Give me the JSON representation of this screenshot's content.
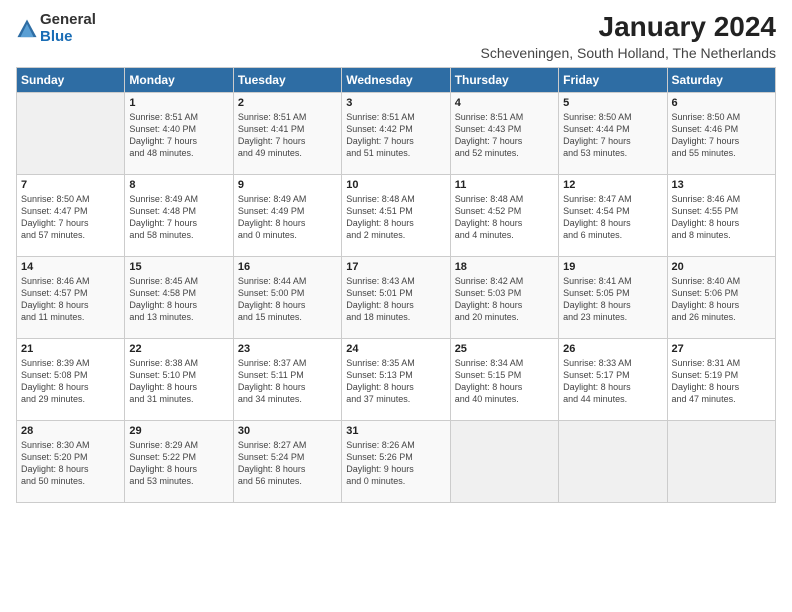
{
  "logo": {
    "general": "General",
    "blue": "Blue"
  },
  "header": {
    "title": "January 2024",
    "subtitle": "Scheveningen, South Holland, The Netherlands"
  },
  "days_of_week": [
    "Sunday",
    "Monday",
    "Tuesday",
    "Wednesday",
    "Thursday",
    "Friday",
    "Saturday"
  ],
  "weeks": [
    [
      {
        "day": "",
        "info": ""
      },
      {
        "day": "1",
        "info": "Sunrise: 8:51 AM\nSunset: 4:40 PM\nDaylight: 7 hours\nand 48 minutes."
      },
      {
        "day": "2",
        "info": "Sunrise: 8:51 AM\nSunset: 4:41 PM\nDaylight: 7 hours\nand 49 minutes."
      },
      {
        "day": "3",
        "info": "Sunrise: 8:51 AM\nSunset: 4:42 PM\nDaylight: 7 hours\nand 51 minutes."
      },
      {
        "day": "4",
        "info": "Sunrise: 8:51 AM\nSunset: 4:43 PM\nDaylight: 7 hours\nand 52 minutes."
      },
      {
        "day": "5",
        "info": "Sunrise: 8:50 AM\nSunset: 4:44 PM\nDaylight: 7 hours\nand 53 minutes."
      },
      {
        "day": "6",
        "info": "Sunrise: 8:50 AM\nSunset: 4:46 PM\nDaylight: 7 hours\nand 55 minutes."
      }
    ],
    [
      {
        "day": "7",
        "info": "Sunrise: 8:50 AM\nSunset: 4:47 PM\nDaylight: 7 hours\nand 57 minutes."
      },
      {
        "day": "8",
        "info": "Sunrise: 8:49 AM\nSunset: 4:48 PM\nDaylight: 7 hours\nand 58 minutes."
      },
      {
        "day": "9",
        "info": "Sunrise: 8:49 AM\nSunset: 4:49 PM\nDaylight: 8 hours\nand 0 minutes."
      },
      {
        "day": "10",
        "info": "Sunrise: 8:48 AM\nSunset: 4:51 PM\nDaylight: 8 hours\nand 2 minutes."
      },
      {
        "day": "11",
        "info": "Sunrise: 8:48 AM\nSunset: 4:52 PM\nDaylight: 8 hours\nand 4 minutes."
      },
      {
        "day": "12",
        "info": "Sunrise: 8:47 AM\nSunset: 4:54 PM\nDaylight: 8 hours\nand 6 minutes."
      },
      {
        "day": "13",
        "info": "Sunrise: 8:46 AM\nSunset: 4:55 PM\nDaylight: 8 hours\nand 8 minutes."
      }
    ],
    [
      {
        "day": "14",
        "info": "Sunrise: 8:46 AM\nSunset: 4:57 PM\nDaylight: 8 hours\nand 11 minutes."
      },
      {
        "day": "15",
        "info": "Sunrise: 8:45 AM\nSunset: 4:58 PM\nDaylight: 8 hours\nand 13 minutes."
      },
      {
        "day": "16",
        "info": "Sunrise: 8:44 AM\nSunset: 5:00 PM\nDaylight: 8 hours\nand 15 minutes."
      },
      {
        "day": "17",
        "info": "Sunrise: 8:43 AM\nSunset: 5:01 PM\nDaylight: 8 hours\nand 18 minutes."
      },
      {
        "day": "18",
        "info": "Sunrise: 8:42 AM\nSunset: 5:03 PM\nDaylight: 8 hours\nand 20 minutes."
      },
      {
        "day": "19",
        "info": "Sunrise: 8:41 AM\nSunset: 5:05 PM\nDaylight: 8 hours\nand 23 minutes."
      },
      {
        "day": "20",
        "info": "Sunrise: 8:40 AM\nSunset: 5:06 PM\nDaylight: 8 hours\nand 26 minutes."
      }
    ],
    [
      {
        "day": "21",
        "info": "Sunrise: 8:39 AM\nSunset: 5:08 PM\nDaylight: 8 hours\nand 29 minutes."
      },
      {
        "day": "22",
        "info": "Sunrise: 8:38 AM\nSunset: 5:10 PM\nDaylight: 8 hours\nand 31 minutes."
      },
      {
        "day": "23",
        "info": "Sunrise: 8:37 AM\nSunset: 5:11 PM\nDaylight: 8 hours\nand 34 minutes."
      },
      {
        "day": "24",
        "info": "Sunrise: 8:35 AM\nSunset: 5:13 PM\nDaylight: 8 hours\nand 37 minutes."
      },
      {
        "day": "25",
        "info": "Sunrise: 8:34 AM\nSunset: 5:15 PM\nDaylight: 8 hours\nand 40 minutes."
      },
      {
        "day": "26",
        "info": "Sunrise: 8:33 AM\nSunset: 5:17 PM\nDaylight: 8 hours\nand 44 minutes."
      },
      {
        "day": "27",
        "info": "Sunrise: 8:31 AM\nSunset: 5:19 PM\nDaylight: 8 hours\nand 47 minutes."
      }
    ],
    [
      {
        "day": "28",
        "info": "Sunrise: 8:30 AM\nSunset: 5:20 PM\nDaylight: 8 hours\nand 50 minutes."
      },
      {
        "day": "29",
        "info": "Sunrise: 8:29 AM\nSunset: 5:22 PM\nDaylight: 8 hours\nand 53 minutes."
      },
      {
        "day": "30",
        "info": "Sunrise: 8:27 AM\nSunset: 5:24 PM\nDaylight: 8 hours\nand 56 minutes."
      },
      {
        "day": "31",
        "info": "Sunrise: 8:26 AM\nSunset: 5:26 PM\nDaylight: 9 hours\nand 0 minutes."
      },
      {
        "day": "",
        "info": ""
      },
      {
        "day": "",
        "info": ""
      },
      {
        "day": "",
        "info": ""
      }
    ]
  ]
}
